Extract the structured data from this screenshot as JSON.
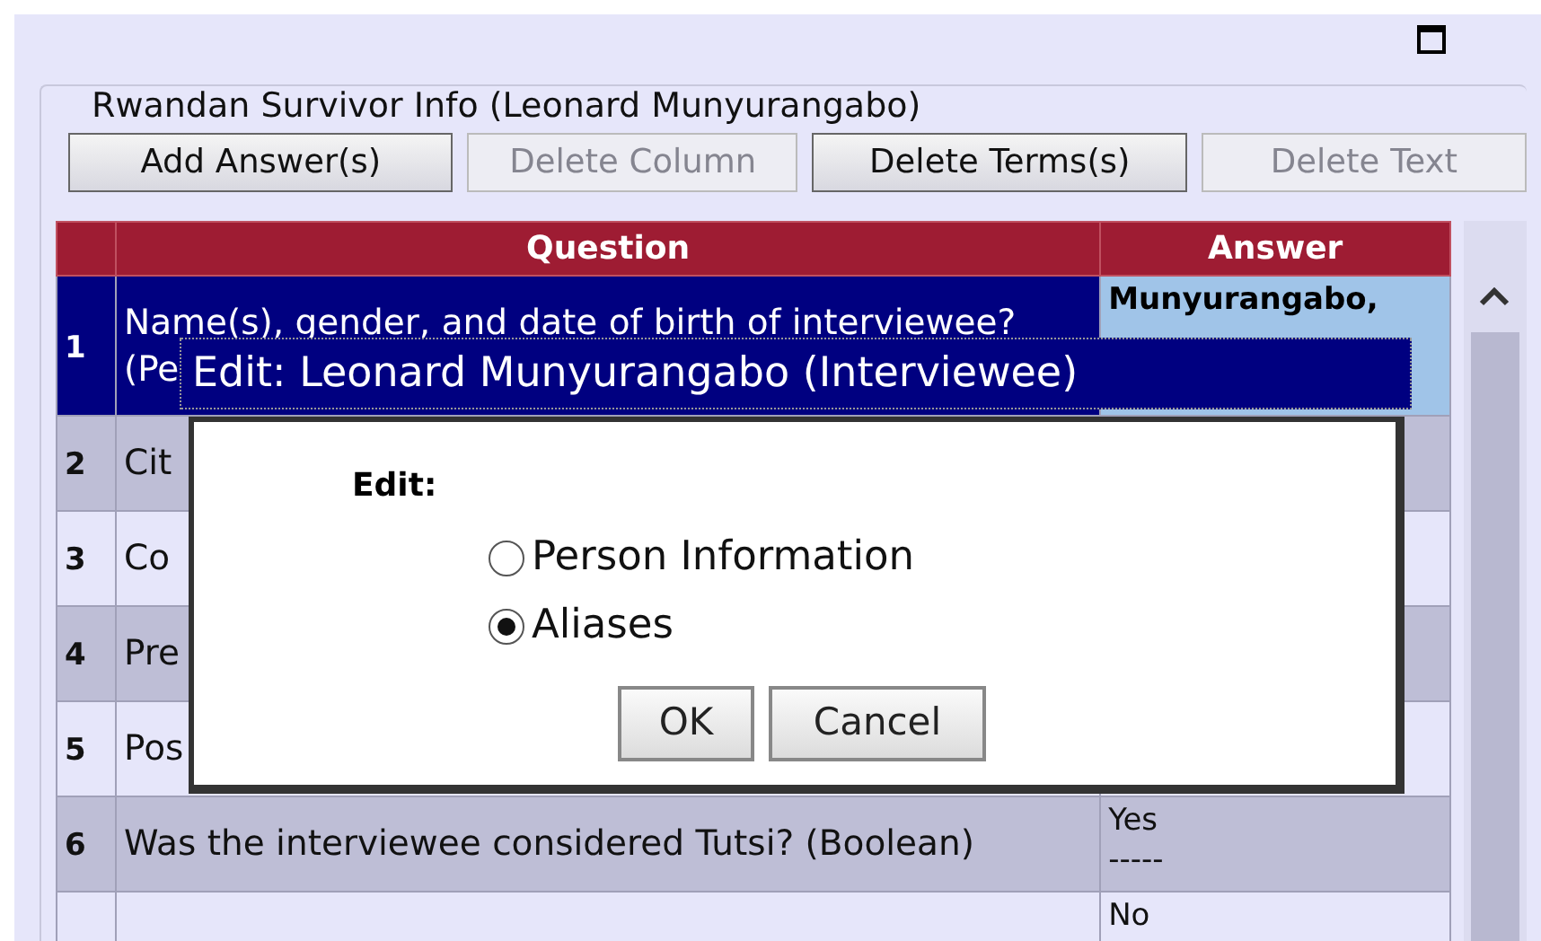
{
  "panel": {
    "legend": "Rwandan Survivor Info (Leonard Munyurangabo)",
    "buttons": [
      {
        "label": "Add Answer(s)",
        "disabled": false
      },
      {
        "label": "Delete Column",
        "disabled": true
      },
      {
        "label": "Delete Terms(s)",
        "disabled": false
      },
      {
        "label": "Delete Text",
        "disabled": true
      }
    ]
  },
  "table": {
    "columns": [
      "Question",
      "Answer"
    ],
    "rows": [
      {
        "number": "1",
        "question_lines": [
          "Name(s), gender, and date of birth of interviewee?",
          "(Pe"
        ],
        "answer_lines": [
          "Munyurangabo,"
        ],
        "selected": true
      },
      {
        "number": "2",
        "question_lines": [
          "Cit"
        ],
        "selected": false
      },
      {
        "number": "3",
        "question_lines": [
          "Co"
        ],
        "selected": false
      },
      {
        "number": "4",
        "question_lines": [
          "Pre"
        ],
        "selected": false
      },
      {
        "number": "5",
        "question_lines": [
          "Pos"
        ],
        "selected": false
      },
      {
        "number": "6",
        "question_lines": [
          "Was the interviewee considered Tutsi? (Boolean)"
        ],
        "answer_lines": [
          "Yes",
          "-----"
        ],
        "selected": false
      },
      {
        "answer_lines": [
          "No"
        ],
        "selected": false
      }
    ]
  },
  "dialog": {
    "title": "Edit: Leonard Munyurangabo (Interviewee)",
    "heading": "Edit:",
    "options": [
      {
        "label": "Person Information",
        "selected": false
      },
      {
        "label": "Aliases",
        "selected": true
      }
    ],
    "buttons": [
      "OK",
      "Cancel"
    ]
  }
}
